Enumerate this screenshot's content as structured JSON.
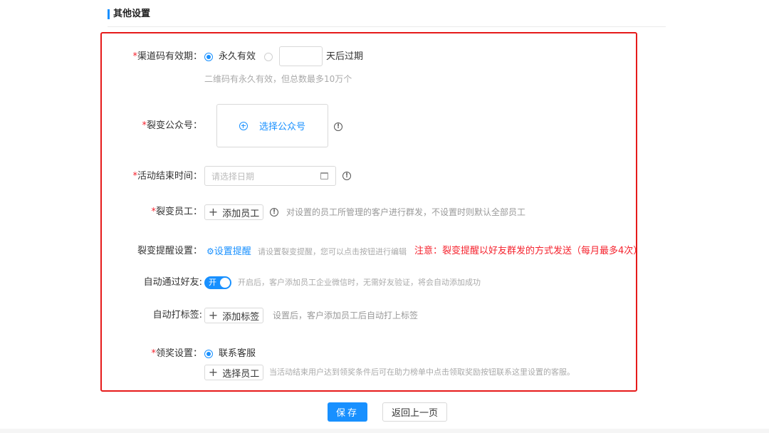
{
  "section": {
    "title": "其他设置"
  },
  "validity": {
    "label": "渠道码有效期：",
    "required_mark": "*",
    "option_forever": "永久有效",
    "days_value": "",
    "option_days_suffix": "天后过期",
    "hint": "二维码有永久有效，但总数最多10万个",
    "selected": "forever"
  },
  "official_account": {
    "label": "裂变公众号：",
    "required_mark": "*",
    "select_label": "选择公众号",
    "icon": "plus-circle-icon",
    "info_icon": "info-circle-icon"
  },
  "end_time": {
    "label": "活动结束时间：",
    "required_mark": "*",
    "placeholder": "请选择日期",
    "icon": "calendar-icon",
    "info_icon": "info-circle-icon"
  },
  "staff": {
    "label": "裂变员工：",
    "required_mark": "*",
    "button_label": "添加员工",
    "hint": "对设置的员工所管理的客户进行群发，不设置时则默认全部员工",
    "info_icon": "info-circle-icon"
  },
  "reminder": {
    "label": "裂变提醒设置：",
    "link_label": "设置提醒",
    "link_icon": "gear-icon",
    "hint": "请设置裂变提醒，您可以点击按钮进行编辑",
    "notice": "注意：裂变提醒以好友群发的方式发送（每月最多4次）",
    "notice_color": "#f5222d"
  },
  "auto_accept": {
    "label": "自动通过好友:",
    "switch_text": "开",
    "enabled": true,
    "hint": "开启后，客户添加员工企业微信时，无需好友验证，将会自动添加成功"
  },
  "auto_tag": {
    "label": "自动打标签:",
    "button_label": "添加标签",
    "hint": "设置后，客户添加员工后自动打上标签"
  },
  "reward": {
    "label": "领奖设置：",
    "required_mark": "*",
    "option_contact": "联系客服",
    "selected": "contact",
    "button_label": "选择员工",
    "hint": "当活动结束用户达到领奖条件后可在助力榜单中点击领取奖励按钮联系这里设置的客服。"
  },
  "footer": {
    "save_label": "保存",
    "back_label": "返回上一页"
  },
  "colors": {
    "accent": "#1890ff",
    "highlight_frame": "#e61a1a",
    "required": "#f5222d"
  }
}
